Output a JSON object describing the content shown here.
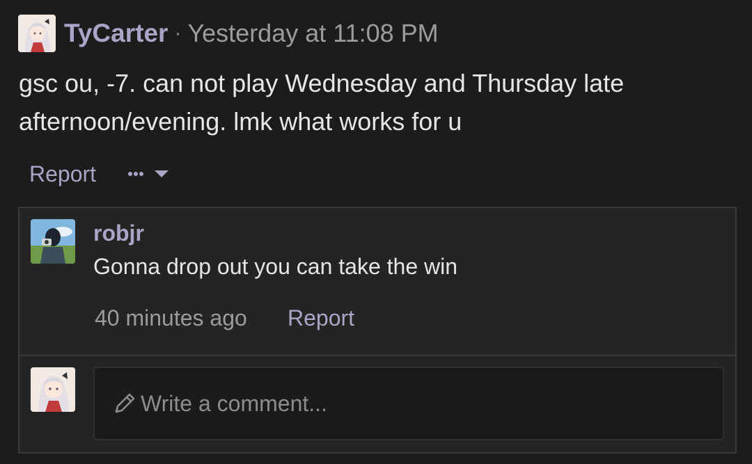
{
  "post": {
    "author": "TyCarter",
    "separator": "·",
    "timestamp": "Yesterday at 11:08 PM",
    "body": "gsc ou, -7. can not play Wednesday and Thursday late afternoon/evening. lmk what works for u",
    "report_label": "Report",
    "more_icon": "ellipsis-dropdown-icon"
  },
  "reply": {
    "author": "robjr",
    "text": "Gonna drop out you can take the win",
    "time": "40 minutes ago",
    "report_label": "Report"
  },
  "composer": {
    "placeholder": "Write a comment...",
    "icon": "pencil-icon"
  },
  "colors": {
    "background": "#1c1c1d",
    "link": "#aba4c7",
    "text": "#e6e6e6",
    "muted": "#9c9c9f",
    "border": "#3a3a3c"
  }
}
